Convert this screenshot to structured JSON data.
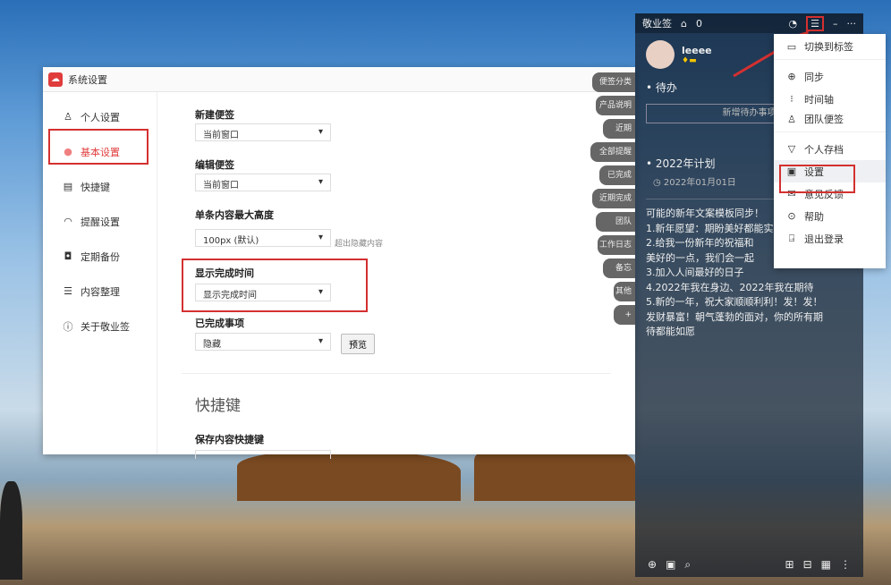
{
  "settings": {
    "title": "系统设置",
    "sidebar": [
      {
        "label": "个人设置",
        "icon": "user-icon"
      },
      {
        "label": "基本设置",
        "icon": "circle-icon"
      },
      {
        "label": "快捷键",
        "icon": "keyboard-icon"
      },
      {
        "label": "提醒设置",
        "icon": "bell-icon"
      },
      {
        "label": "定期备份",
        "icon": "backup-icon"
      },
      {
        "label": "内容整理",
        "icon": "list-icon"
      },
      {
        "label": "关于敬业签",
        "icon": "info-icon"
      }
    ],
    "fields": [
      {
        "label": "新建便签",
        "value": "当前窗口"
      },
      {
        "label": "编辑便签",
        "value": "当前窗口"
      },
      {
        "label": "单条内容最大高度",
        "value": "100px (默认)",
        "hint": "超出隐藏内容"
      },
      {
        "label": "显示完成时间",
        "value": "显示完成时间"
      },
      {
        "label": "已完成事项",
        "value": "隐藏",
        "button": "预览"
      }
    ],
    "section": "快捷键",
    "shortcut_label": "保存内容快捷键",
    "side_tabs": [
      "便签分类",
      "产品说明",
      "近期",
      "全部提醒",
      "已完成",
      "近期完成",
      "团队",
      "工作日志",
      "备忘",
      "其他",
      "+"
    ]
  },
  "note": {
    "app": "敬业签",
    "count": "0",
    "user": "leeee",
    "section": "待办",
    "add_placeholder": "新增待办事项",
    "items": [
      {
        "title": "2022年计划",
        "date": "2022年01月01日"
      }
    ],
    "body": "可能的新年文案模板同步！\n1.新年愿望：期盼美好都能实现\n2.给我一份新年的祝福和\n美好的一点，我们会一起\n3.加入人间最好的日子\n4.2022年我在身边、2022年我在期待\n5.新的一年，祝大家顺顺利利！发！发！\n发财暴富！朝气蓬勃的面对，你的所有期\n待都能如愿"
  },
  "menu": [
    {
      "label": "切换到标签",
      "icon": "tag-icon"
    },
    {
      "label": "同步",
      "icon": "sync-icon"
    },
    {
      "label": "时间轴",
      "icon": "timeline-icon"
    },
    {
      "label": "团队便签",
      "icon": "team-icon"
    },
    {
      "label": "个人存档",
      "icon": "archive-icon"
    },
    {
      "label": "设置",
      "icon": "settings-icon"
    },
    {
      "label": "意见反馈",
      "icon": "mail-icon"
    },
    {
      "label": "帮助",
      "icon": "help-icon"
    },
    {
      "label": "退出登录",
      "icon": "logout-icon"
    }
  ],
  "colors": {
    "accent": "#e03c3c",
    "highlight": "#d43030"
  }
}
